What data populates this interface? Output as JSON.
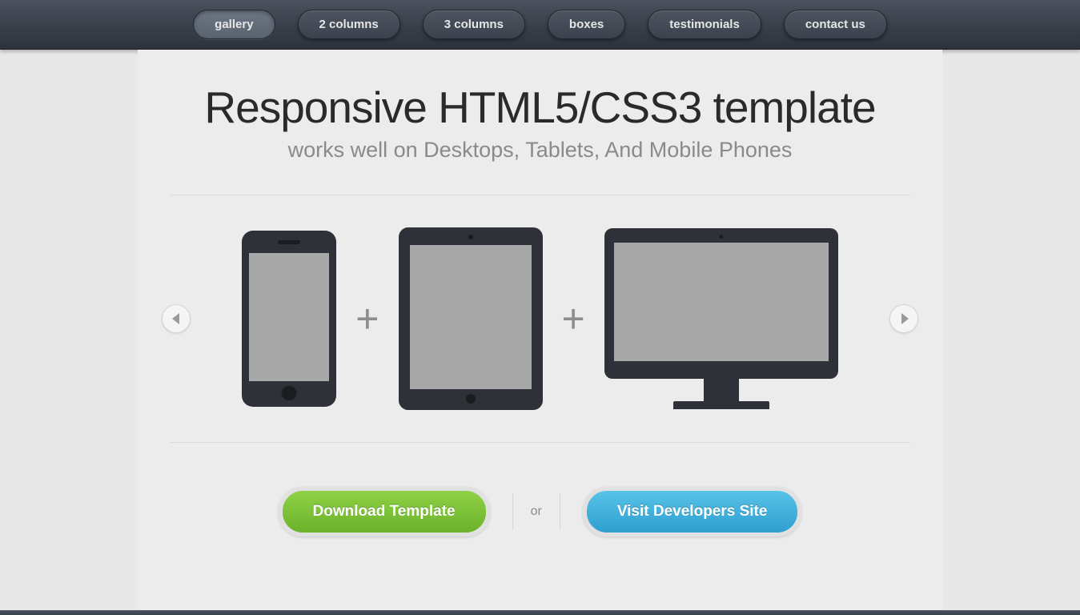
{
  "nav": {
    "items": [
      {
        "label": "gallery",
        "active": true
      },
      {
        "label": "2 columns",
        "active": false
      },
      {
        "label": "3 columns",
        "active": false
      },
      {
        "label": "boxes",
        "active": false
      },
      {
        "label": "testimonials",
        "active": false
      },
      {
        "label": "contact us",
        "active": false
      }
    ]
  },
  "hero": {
    "heading": "Responsive HTML5/CSS3 template",
    "subheading": "works well on Desktops, Tablets, And Mobile Phones"
  },
  "slider": {
    "plus": "+"
  },
  "cta": {
    "download_label": "Download Template",
    "or_label": "or",
    "visit_label": "Visit Developers Site"
  }
}
